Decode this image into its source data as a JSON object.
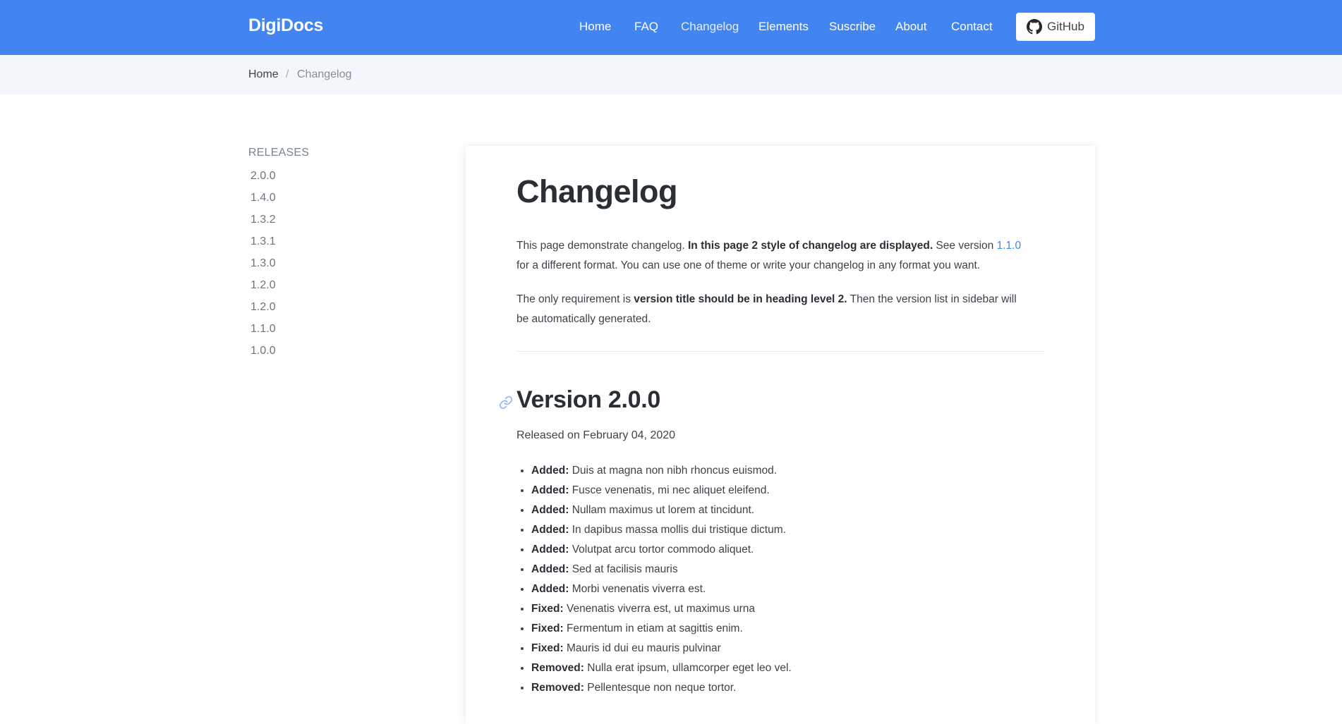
{
  "header": {
    "brand": "DigiDocs",
    "nav": [
      "Home",
      "FAQ",
      "Changelog",
      "Elements",
      "Suscribe",
      "About",
      "Contact"
    ],
    "active_nav": "Changelog",
    "github_label": "GitHub",
    "background_color": "#4285f0"
  },
  "breadcrumb": {
    "home": "Home",
    "separator": "/",
    "current": "Changelog"
  },
  "sidebar": {
    "title": "RELEASES",
    "releases": [
      "2.0.0",
      "1.4.0",
      "1.3.2",
      "1.3.1",
      "1.3.0",
      "1.2.0",
      "1.2.0",
      "1.1.0",
      "1.0.0"
    ]
  },
  "main": {
    "title": "Changelog",
    "intro": {
      "text_1": "This page demonstrate changelog. ",
      "bold_1": "In this page 2 style of changelog are displayed.",
      "text_2": " See version ",
      "link": "1.1.0",
      "text_3": " for a different format. You can use one of theme or write your changelog in any format you want."
    },
    "requirement": {
      "text_1": "The only requirement is ",
      "bold_1": "version title should be in heading level 2.",
      "text_2": " Then the version list in sidebar will be automatically generated."
    },
    "version": {
      "title": "Version 2.0.0",
      "anchor_icon": "link-icon",
      "released": "Released on February 04, 2020",
      "changes": [
        {
          "type": "Added:",
          "text": " Duis at magna non nibh rhoncus euismod."
        },
        {
          "type": "Added:",
          "text": " Fusce venenatis, mi nec aliquet eleifend."
        },
        {
          "type": "Added:",
          "text": " Nullam maximus ut lorem at tincidunt."
        },
        {
          "type": "Added:",
          "text": " In dapibus massa mollis dui tristique dictum."
        },
        {
          "type": "Added:",
          "text": " Volutpat arcu tortor commodo aliquet."
        },
        {
          "type": "Added:",
          "text": " Sed at facilisis mauris"
        },
        {
          "type": "Added:",
          "text": " Morbi venenatis viverra est."
        },
        {
          "type": "Fixed:",
          "text": " Venenatis viverra est, ut maximus urna"
        },
        {
          "type": "Fixed:",
          "text": " Fermentum in etiam at sagittis enim."
        },
        {
          "type": "Fixed:",
          "text": " Mauris id dui eu mauris pulvinar"
        },
        {
          "type": "Removed:",
          "text": " Nulla erat ipsum, ullamcorper eget leo vel."
        },
        {
          "type": "Removed:",
          "text": " Pellentesque non neque tortor."
        }
      ]
    },
    "link_color": "#4285f0"
  }
}
